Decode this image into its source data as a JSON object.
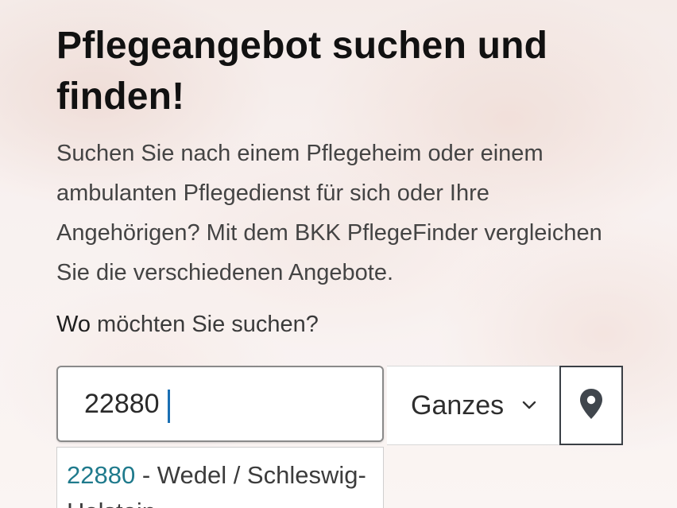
{
  "hero": {
    "title": "Pflegeangebot suchen und finden!",
    "intro": "Suchen Sie nach einem Pflegeheim oder einem ambulanten Pflegedienst für sich oder Ihre Angehörigen? Mit dem BKK PflegeFinder vergleichen Sie die verschiedenen Angebote."
  },
  "search": {
    "label_strong": "Wo",
    "label_rest": " möchten Sie suchen?",
    "zip_value": "22880",
    "radius_selected": "Ganzes Bundesgebiet",
    "location_icon": "map-pin-icon",
    "radius_icon": "chevron-down-icon"
  },
  "suggestions": [
    {
      "zip": "22880",
      "separator": " - ",
      "place": "Wedel / Schleswig-Holstein"
    }
  ],
  "colors": {
    "title": "#111111",
    "body_text": "#444444",
    "suggestion_zip": "#1f7a8c",
    "caret": "#1a6fb3",
    "location_border": "#3a3f45"
  }
}
